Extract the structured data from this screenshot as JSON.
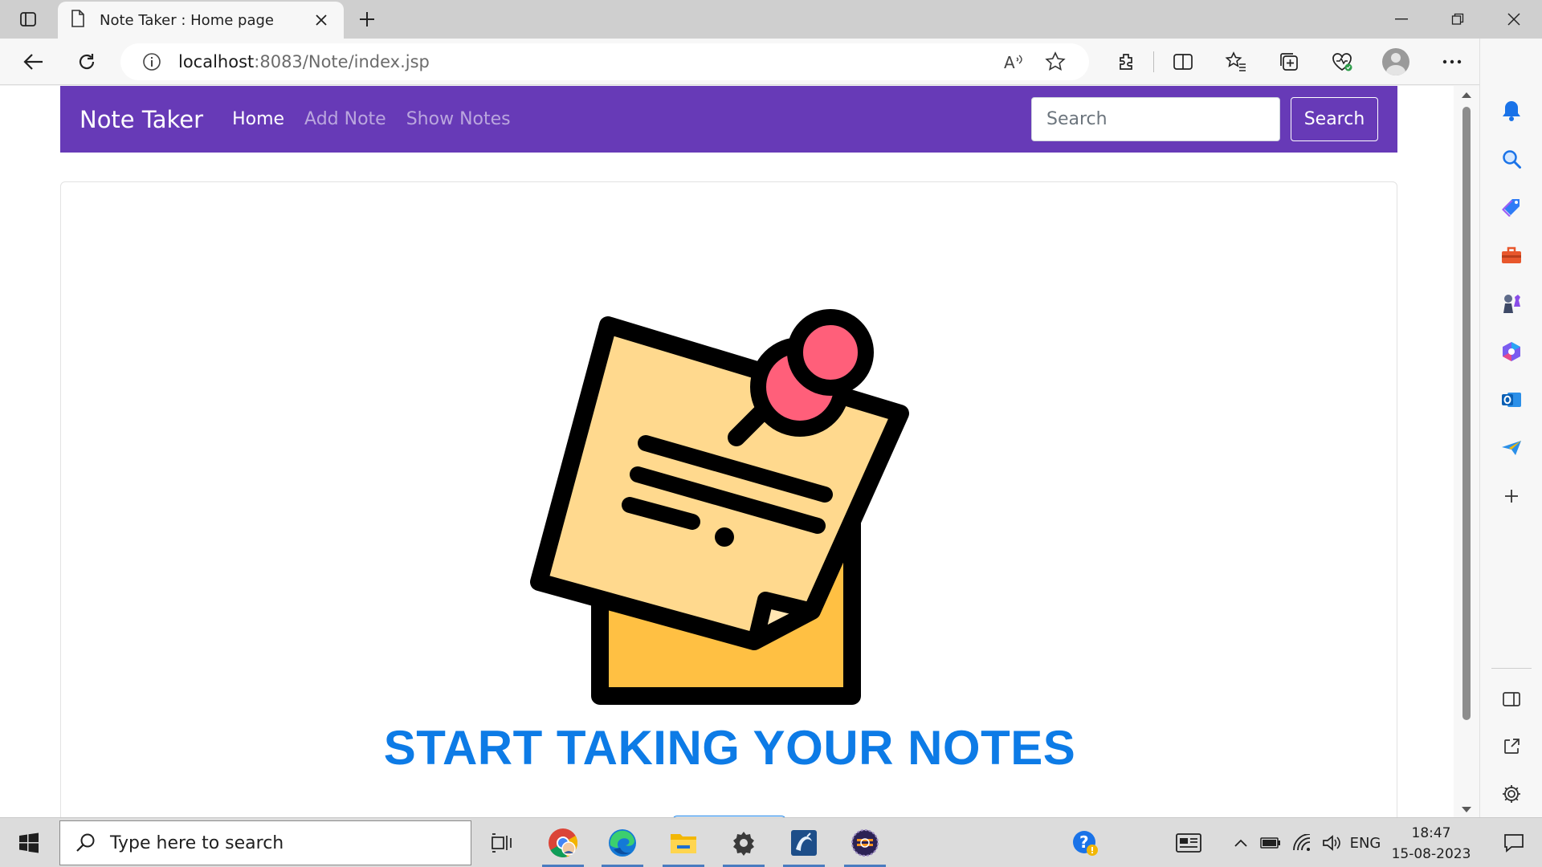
{
  "browser": {
    "tab_title": "Note Taker : Home page",
    "address_host": "localhost",
    "address_rest": ":8083/Note/index.jsp"
  },
  "navbar": {
    "brand": "Note Taker",
    "links": [
      {
        "label": "Home",
        "active": true
      },
      {
        "label": "Add Note",
        "active": false
      },
      {
        "label": "Show Notes",
        "active": false
      }
    ],
    "search_placeholder": "Search",
    "search_button": "Search",
    "color": "#673ab7"
  },
  "hero": {
    "title": "START TAKING YOUR NOTES",
    "title_color": "#0d7be6",
    "image": "sticky-note-with-pin-illustration"
  },
  "taskbar": {
    "search_placeholder": "Type here to search",
    "language": "ENG",
    "time": "18:47",
    "date": "15-08-2023"
  }
}
